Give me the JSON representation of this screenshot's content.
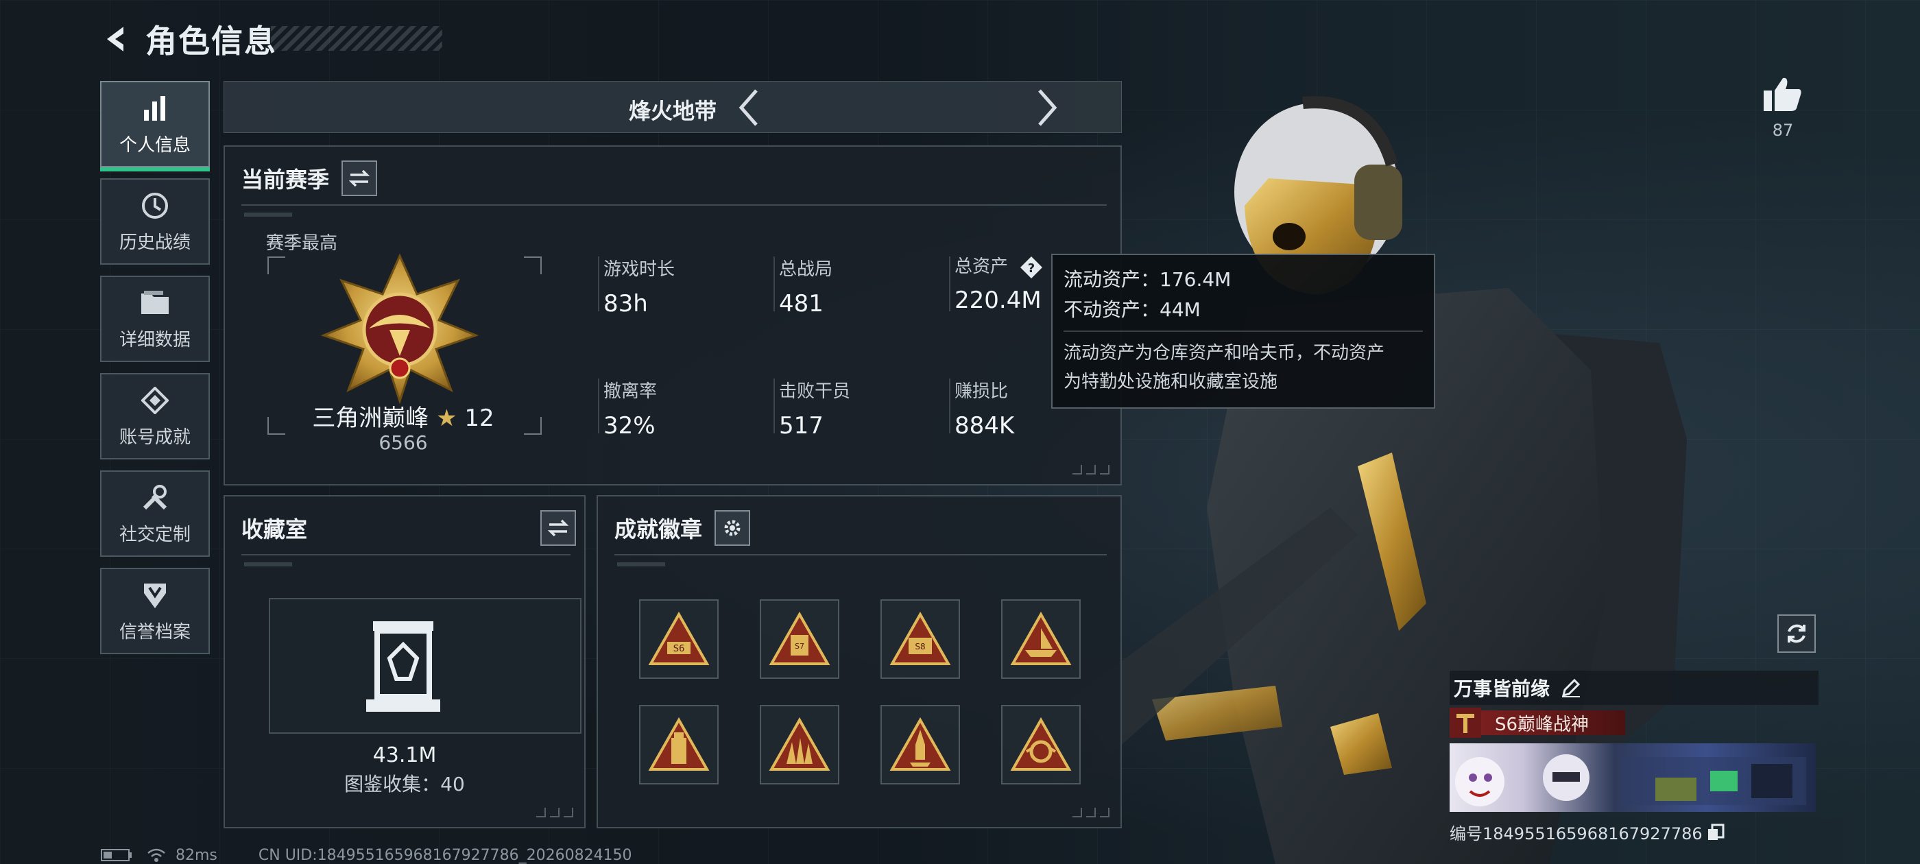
{
  "header": {
    "title": "角色信息"
  },
  "sidebar": {
    "items": [
      {
        "label": "个人信息",
        "icon": "bar-chart-icon",
        "active": true
      },
      {
        "label": "历史战绩",
        "icon": "history-clock-icon",
        "active": false
      },
      {
        "label": "详细数据",
        "icon": "folder-icon",
        "active": false
      },
      {
        "label": "账号成就",
        "icon": "achievement-diamond-icon",
        "active": false
      },
      {
        "label": "社交定制",
        "icon": "wrench-icon",
        "active": false
      },
      {
        "label": "信誉档案",
        "icon": "shield-badge-icon",
        "active": false
      }
    ]
  },
  "mode": {
    "title": "烽火地带"
  },
  "season": {
    "title": "当前赛季",
    "best_label": "赛季最高",
    "rank_name": "三角洲巅峰",
    "rank_star": "★",
    "rank_level": "12",
    "rank_score": "6566",
    "stats": [
      {
        "label": "游戏时长",
        "value": "83h"
      },
      {
        "label": "总战局",
        "value": "481"
      },
      {
        "label": "总资产",
        "value": "220.4M"
      },
      {
        "label": "撤离率",
        "value": "32%"
      },
      {
        "label": "击败干员",
        "value": "517"
      },
      {
        "label": "赚损比",
        "value": "884K"
      }
    ]
  },
  "tooltip": {
    "liquid": "流动资产：176.4M",
    "fixed": "不动资产：44M",
    "desc_line1": "流动资产为仓库资产和哈夫币，不动资产",
    "desc_line2": "为特勤处设施和收藏室设施"
  },
  "collection": {
    "title": "收藏室",
    "value": "43.1M",
    "count": "图鉴收集：40"
  },
  "badges": {
    "title": "成就徽章",
    "items": [
      {
        "icon": "badge-s6-icon"
      },
      {
        "icon": "badge-s7-icon"
      },
      {
        "icon": "badge-s8-icon"
      },
      {
        "icon": "badge-ship-icon"
      },
      {
        "icon": "badge-tower-icon"
      },
      {
        "icon": "badge-warriors-icon"
      },
      {
        "icon": "badge-rocket-icon"
      },
      {
        "icon": "badge-emblem-icon"
      }
    ]
  },
  "likes": {
    "count": "87"
  },
  "player": {
    "name": "万事皆前缘",
    "title": "S6巅峰战神",
    "id": "编号1849551659681679277​86"
  },
  "status": {
    "ping": "82ms",
    "uid": "CN UID:18495516596816792778​6_20260824150"
  },
  "colors": {
    "accent": "#35c28a",
    "gold": "#c9a24a",
    "panel": "#1a2128"
  }
}
